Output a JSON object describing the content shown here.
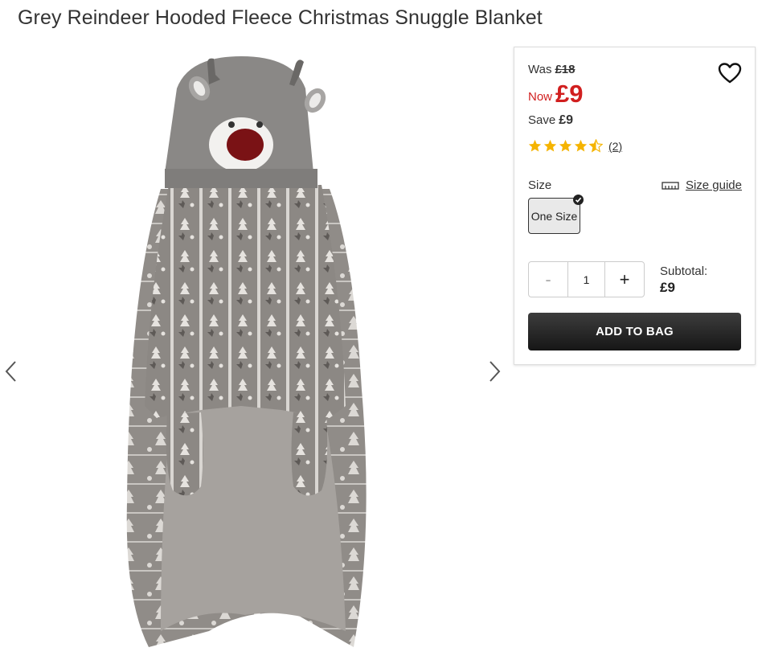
{
  "product": {
    "title": "Grey Reindeer Hooded Fleece Christmas Snuggle Blanket"
  },
  "price": {
    "was_label": "Was",
    "was_value": "£18",
    "now_label": "Now",
    "now_value": "£9",
    "save_label": "Save",
    "save_value": "£9",
    "accent_color": "#d11f1f"
  },
  "rating": {
    "value": 4.5,
    "max": 5,
    "reviews": "(2)",
    "star_color": "#f5b400"
  },
  "size": {
    "label": "Size",
    "guide_label": "Size guide",
    "options": [
      {
        "label": "One Size",
        "selected": true
      }
    ]
  },
  "quantity": {
    "minus": "-",
    "value": "1",
    "plus": "+"
  },
  "subtotal": {
    "label": "Subtotal:",
    "value": "£9"
  },
  "add_to_bag": {
    "label": "ADD TO BAG"
  },
  "icons": {
    "wishlist": "heart-icon",
    "prev": "chevron-left-icon",
    "next": "chevron-right-icon",
    "ruler": "ruler-icon",
    "check": "check-icon"
  }
}
